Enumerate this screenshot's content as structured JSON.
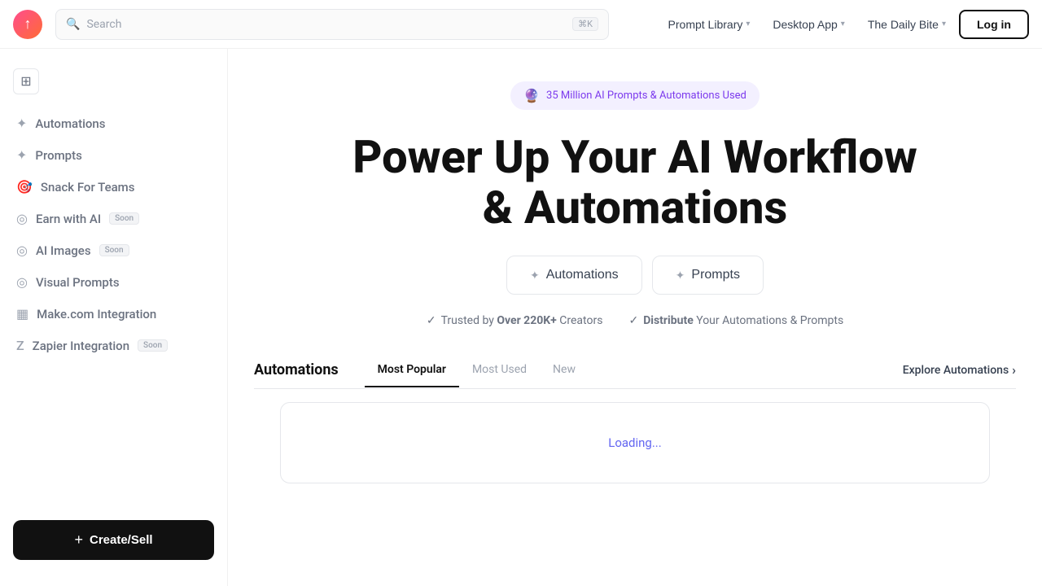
{
  "header": {
    "logo_alt": "SnackPrompt logo",
    "search_placeholder": "Search",
    "search_shortcut": "⌘K",
    "nav_items": [
      {
        "label": "Prompt Library",
        "has_chevron": true
      },
      {
        "label": "Desktop App",
        "has_chevron": true
      },
      {
        "label": "The Daily Bite",
        "has_chevron": true
      }
    ],
    "login_label": "Log in"
  },
  "sidebar": {
    "collapse_icon": "☰",
    "items": [
      {
        "label": "Automations",
        "icon": "✦"
      },
      {
        "label": "Prompts",
        "icon": "✦"
      },
      {
        "label": "Snack For Teams",
        "icon": "🎯"
      },
      {
        "label": "Earn with AI",
        "icon": "◎",
        "badge": "Soon"
      },
      {
        "label": "AI Images",
        "icon": "◎",
        "badge": "Soon"
      },
      {
        "label": "Visual Prompts",
        "icon": "◎"
      },
      {
        "label": "Make.com Integration",
        "icon": "▦"
      },
      {
        "label": "Zapier Integration",
        "icon": "Z",
        "badge": "Soon"
      }
    ],
    "create_sell_label": "Create/Sell",
    "plus_icon": "+"
  },
  "hero": {
    "badge_icon": "🔮",
    "badge_text": "35 Million AI Prompts & Automations Used",
    "title_line1": "Power Up Your AI Workflow",
    "title_line2": "& Automations",
    "buttons": [
      {
        "icon": "✦",
        "label": "Automations"
      },
      {
        "icon": "✦",
        "label": "Prompts"
      }
    ],
    "trust_items": [
      {
        "check": "✓",
        "text_plain": "Trusted by ",
        "text_bold": "Over 220K+",
        "text_end": " Creators"
      },
      {
        "check": "✓",
        "text_bold": "Distribute",
        "text_end": " Your Automations & Prompts"
      }
    ]
  },
  "tabs_section": {
    "title": "Automations",
    "tabs": [
      {
        "label": "Most Popular",
        "active": true
      },
      {
        "label": "Most Used",
        "active": false
      },
      {
        "label": "New",
        "active": false
      }
    ],
    "explore_label": "Explore Automations",
    "explore_arrow": "›",
    "loading_text": "Loading..."
  }
}
